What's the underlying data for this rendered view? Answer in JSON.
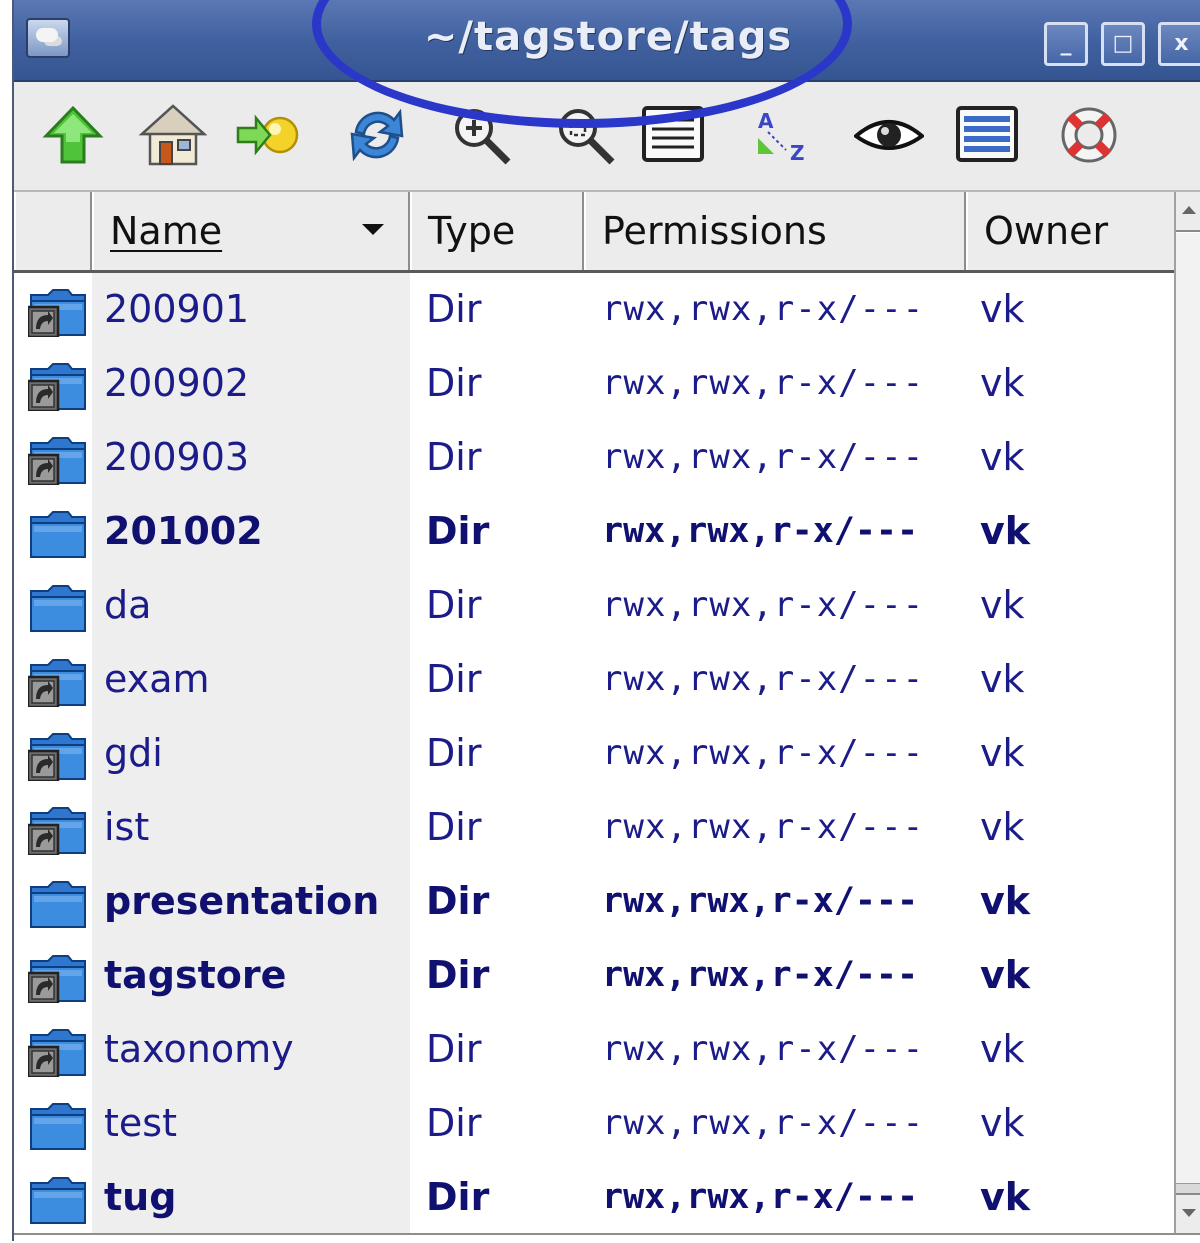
{
  "window": {
    "title": "~/tagstore/tags",
    "buttons": {
      "minimize": "_",
      "maximize": "□",
      "close": "x"
    }
  },
  "toolbar": {
    "items": [
      {
        "icon": "up-arrow-icon"
      },
      {
        "icon": "home-icon"
      },
      {
        "icon": "go-icon"
      },
      {
        "icon": "reload-icon"
      },
      {
        "icon": "zoom-in-icon"
      },
      {
        "icon": "zoom-fit-icon"
      },
      {
        "icon": "details-view-icon"
      },
      {
        "icon": "sort-az-icon"
      },
      {
        "icon": "show-hidden-eye-icon"
      },
      {
        "icon": "list-view-icon"
      },
      {
        "icon": "help-lifebuoy-icon"
      }
    ]
  },
  "columns": {
    "name": "Name",
    "type": "Type",
    "permissions": "Permissions",
    "owner": "Owner"
  },
  "files": [
    {
      "name": "200901",
      "type": "Dir",
      "permissions": "rwx,rwx,r-x/---",
      "owner": "vk",
      "bold": false,
      "icon": "folder-link-icon"
    },
    {
      "name": "200902",
      "type": "Dir",
      "permissions": "rwx,rwx,r-x/---",
      "owner": "vk",
      "bold": false,
      "icon": "folder-link-icon"
    },
    {
      "name": "200903",
      "type": "Dir",
      "permissions": "rwx,rwx,r-x/---",
      "owner": "vk",
      "bold": false,
      "icon": "folder-link-icon"
    },
    {
      "name": "201002",
      "type": "Dir",
      "permissions": "rwx,rwx,r-x/---",
      "owner": "vk",
      "bold": true,
      "icon": "folder-icon"
    },
    {
      "name": "da",
      "type": "Dir",
      "permissions": "rwx,rwx,r-x/---",
      "owner": "vk",
      "bold": false,
      "icon": "folder-icon"
    },
    {
      "name": "exam",
      "type": "Dir",
      "permissions": "rwx,rwx,r-x/---",
      "owner": "vk",
      "bold": false,
      "icon": "folder-link-icon"
    },
    {
      "name": "gdi",
      "type": "Dir",
      "permissions": "rwx,rwx,r-x/---",
      "owner": "vk",
      "bold": false,
      "icon": "folder-link-icon"
    },
    {
      "name": "ist",
      "type": "Dir",
      "permissions": "rwx,rwx,r-x/---",
      "owner": "vk",
      "bold": false,
      "icon": "folder-link-icon"
    },
    {
      "name": "presentation",
      "type": "Dir",
      "permissions": "rwx,rwx,r-x/---",
      "owner": "vk",
      "bold": true,
      "icon": "folder-icon"
    },
    {
      "name": "tagstore",
      "type": "Dir",
      "permissions": "rwx,rwx,r-x/---",
      "owner": "vk",
      "bold": true,
      "icon": "folder-link-icon"
    },
    {
      "name": "taxonomy",
      "type": "Dir",
      "permissions": "rwx,rwx,r-x/---",
      "owner": "vk",
      "bold": false,
      "icon": "folder-link-icon"
    },
    {
      "name": "test",
      "type": "Dir",
      "permissions": "rwx,rwx,r-x/---",
      "owner": "vk",
      "bold": false,
      "icon": "folder-icon"
    },
    {
      "name": "tug",
      "type": "Dir",
      "permissions": "rwx,rwx,r-x/---",
      "owner": "vk",
      "bold": true,
      "icon": "folder-icon"
    }
  ],
  "colors": {
    "titlebar": "#3f5f9e",
    "highlight": "#2a37c9",
    "text": "#1b1b8a"
  }
}
